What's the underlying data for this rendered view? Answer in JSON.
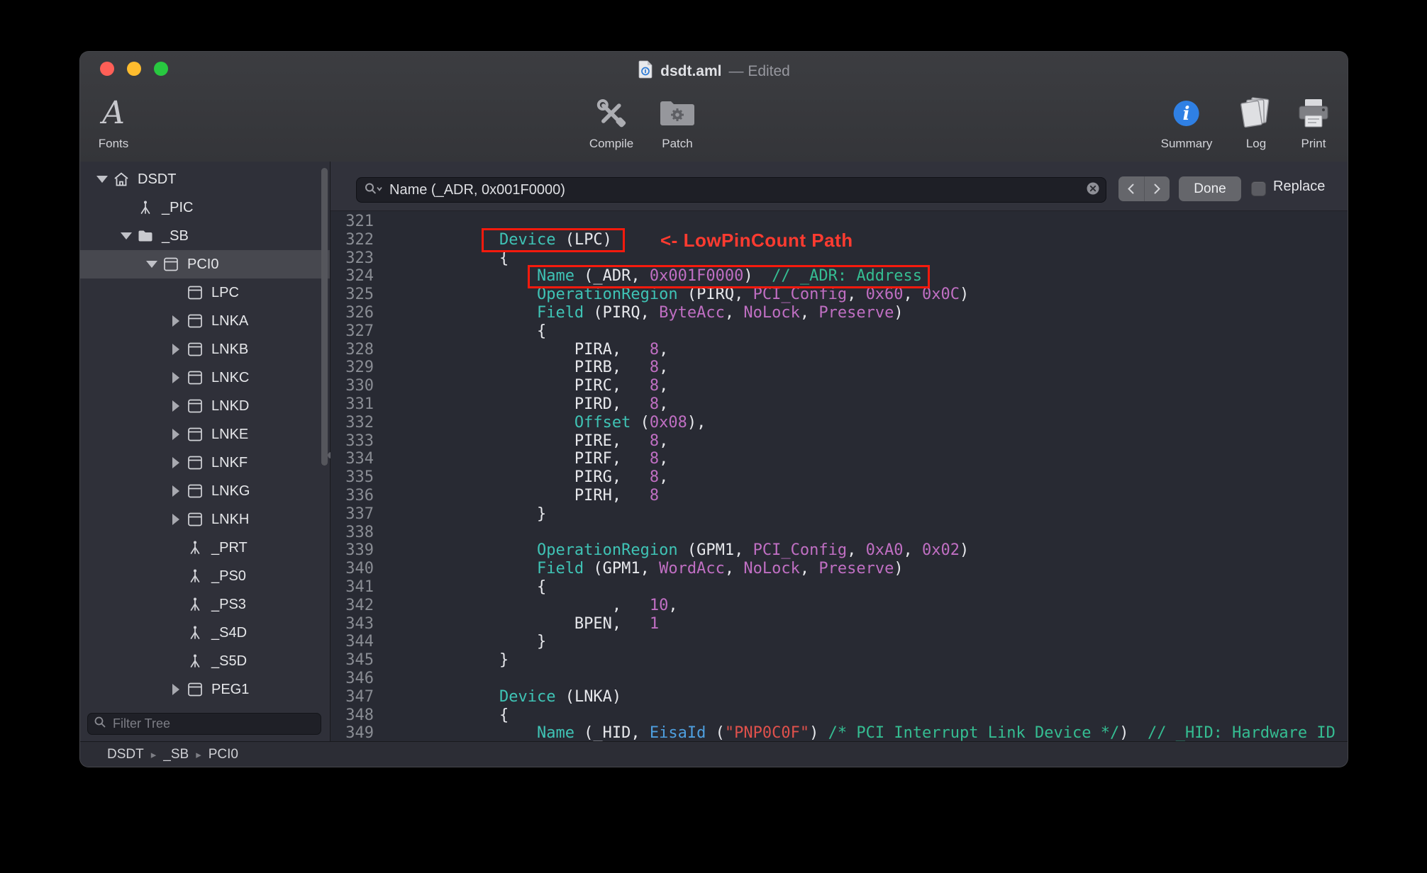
{
  "window": {
    "title": "dsdt.aml",
    "title_suffix": "— Edited"
  },
  "toolbar": {
    "fonts": "Fonts",
    "compile": "Compile",
    "patch": "Patch",
    "summary": "Summary",
    "log": "Log",
    "print": "Print"
  },
  "sidebar": {
    "filter_placeholder": "Filter Tree",
    "items": [
      {
        "label": "DSDT",
        "level": 0,
        "disclosure": "open",
        "icon": "home",
        "selected": false
      },
      {
        "label": "_PIC",
        "level": 1,
        "disclosure": "none",
        "icon": "method",
        "selected": false
      },
      {
        "label": "_SB",
        "level": 1,
        "disclosure": "open",
        "icon": "folder",
        "selected": false
      },
      {
        "label": "PCI0",
        "level": 2,
        "disclosure": "open",
        "icon": "device",
        "selected": true
      },
      {
        "label": "LPC",
        "level": 3,
        "disclosure": "none",
        "icon": "device",
        "selected": false
      },
      {
        "label": "LNKA",
        "level": 3,
        "disclosure": "closed",
        "icon": "device",
        "selected": false
      },
      {
        "label": "LNKB",
        "level": 3,
        "disclosure": "closed",
        "icon": "device",
        "selected": false
      },
      {
        "label": "LNKC",
        "level": 3,
        "disclosure": "closed",
        "icon": "device",
        "selected": false
      },
      {
        "label": "LNKD",
        "level": 3,
        "disclosure": "closed",
        "icon": "device",
        "selected": false
      },
      {
        "label": "LNKE",
        "level": 3,
        "disclosure": "closed",
        "icon": "device",
        "selected": false
      },
      {
        "label": "LNKF",
        "level": 3,
        "disclosure": "closed",
        "icon": "device",
        "selected": false
      },
      {
        "label": "LNKG",
        "level": 3,
        "disclosure": "closed",
        "icon": "device",
        "selected": false
      },
      {
        "label": "LNKH",
        "level": 3,
        "disclosure": "closed",
        "icon": "device",
        "selected": false
      },
      {
        "label": "_PRT",
        "level": 3,
        "disclosure": "none",
        "icon": "method",
        "selected": false
      },
      {
        "label": "_PS0",
        "level": 3,
        "disclosure": "none",
        "icon": "method",
        "selected": false
      },
      {
        "label": "_PS3",
        "level": 3,
        "disclosure": "none",
        "icon": "method",
        "selected": false
      },
      {
        "label": "_S4D",
        "level": 3,
        "disclosure": "none",
        "icon": "method",
        "selected": false
      },
      {
        "label": "_S5D",
        "level": 3,
        "disclosure": "none",
        "icon": "method",
        "selected": false
      },
      {
        "label": "PEG1",
        "level": 3,
        "disclosure": "closed",
        "icon": "device",
        "selected": false
      }
    ]
  },
  "searchbar": {
    "query": "Name (_ADR, 0x001F0000)",
    "done_label": "Done",
    "replace_label": "Replace",
    "replace_checked": false
  },
  "statusbar": {
    "breadcrumbs": [
      "DSDT",
      "_SB",
      "PCI0"
    ]
  },
  "annotations": {
    "note": "<- LowPinCount Path"
  },
  "colors": {
    "annotation_red": "#FF3B30",
    "box_red": "#F71A0D",
    "syntax_keyword": "#3FC3B5",
    "syntax_constant": "#C06FC3",
    "syntax_string": "#E0514C",
    "syntax_comment": "#35BD92",
    "syntax_predefined": "#4E9FDF",
    "syntax_plain": "#E7E8EC",
    "editor_bg": "#282A33"
  },
  "editor": {
    "lines": [
      {
        "n": "321",
        "seg": []
      },
      {
        "n": "322",
        "seg": [
          [
            "p",
            "        "
          ],
          [
            "k",
            "Device"
          ],
          [
            "p",
            " (LPC)"
          ]
        ]
      },
      {
        "n": "323",
        "seg": [
          [
            "p",
            "        {"
          ]
        ]
      },
      {
        "n": "324",
        "seg": [
          [
            "p",
            "            "
          ],
          [
            "k",
            "Name"
          ],
          [
            "p",
            " (_ADR, "
          ],
          [
            "c",
            "0x001F0000"
          ],
          [
            "p",
            ")  "
          ],
          [
            "m",
            "// _ADR: Address"
          ]
        ]
      },
      {
        "n": "325",
        "seg": [
          [
            "p",
            "            "
          ],
          [
            "k",
            "OperationRegion"
          ],
          [
            "p",
            " (PIRQ, "
          ],
          [
            "c",
            "PCI_Config"
          ],
          [
            "p",
            ", "
          ],
          [
            "c",
            "0x60"
          ],
          [
            "p",
            ", "
          ],
          [
            "c",
            "0x0C"
          ],
          [
            "p",
            ")"
          ]
        ]
      },
      {
        "n": "326",
        "seg": [
          [
            "p",
            "            "
          ],
          [
            "k",
            "Field"
          ],
          [
            "p",
            " (PIRQ, "
          ],
          [
            "c",
            "ByteAcc"
          ],
          [
            "p",
            ", "
          ],
          [
            "c",
            "NoLock"
          ],
          [
            "p",
            ", "
          ],
          [
            "c",
            "Preserve"
          ],
          [
            "p",
            ")"
          ]
        ]
      },
      {
        "n": "327",
        "seg": [
          [
            "p",
            "            {"
          ]
        ]
      },
      {
        "n": "328",
        "seg": [
          [
            "p",
            "                PIRA,   "
          ],
          [
            "c",
            "8"
          ],
          [
            "p",
            ","
          ]
        ]
      },
      {
        "n": "329",
        "seg": [
          [
            "p",
            "                PIRB,   "
          ],
          [
            "c",
            "8"
          ],
          [
            "p",
            ","
          ]
        ]
      },
      {
        "n": "330",
        "seg": [
          [
            "p",
            "                PIRC,   "
          ],
          [
            "c",
            "8"
          ],
          [
            "p",
            ","
          ]
        ]
      },
      {
        "n": "331",
        "seg": [
          [
            "p",
            "                PIRD,   "
          ],
          [
            "c",
            "8"
          ],
          [
            "p",
            ","
          ]
        ]
      },
      {
        "n": "332",
        "seg": [
          [
            "p",
            "                "
          ],
          [
            "k",
            "Offset"
          ],
          [
            "p",
            " ("
          ],
          [
            "c",
            "0x08"
          ],
          [
            "p",
            "),"
          ]
        ]
      },
      {
        "n": "333",
        "seg": [
          [
            "p",
            "                PIRE,   "
          ],
          [
            "c",
            "8"
          ],
          [
            "p",
            ","
          ]
        ]
      },
      {
        "n": "334",
        "seg": [
          [
            "p",
            "                PIRF,   "
          ],
          [
            "c",
            "8"
          ],
          [
            "p",
            ","
          ]
        ]
      },
      {
        "n": "335",
        "seg": [
          [
            "p",
            "                PIRG,   "
          ],
          [
            "c",
            "8"
          ],
          [
            "p",
            ","
          ]
        ]
      },
      {
        "n": "336",
        "seg": [
          [
            "p",
            "                PIRH,   "
          ],
          [
            "c",
            "8"
          ]
        ]
      },
      {
        "n": "337",
        "seg": [
          [
            "p",
            "            }"
          ]
        ]
      },
      {
        "n": "338",
        "seg": []
      },
      {
        "n": "339",
        "seg": [
          [
            "p",
            "            "
          ],
          [
            "k",
            "OperationRegion"
          ],
          [
            "p",
            " (GPM1, "
          ],
          [
            "c",
            "PCI_Config"
          ],
          [
            "p",
            ", "
          ],
          [
            "c",
            "0xA0"
          ],
          [
            "p",
            ", "
          ],
          [
            "c",
            "0x02"
          ],
          [
            "p",
            ")"
          ]
        ]
      },
      {
        "n": "340",
        "seg": [
          [
            "p",
            "            "
          ],
          [
            "k",
            "Field"
          ],
          [
            "p",
            " (GPM1, "
          ],
          [
            "c",
            "WordAcc"
          ],
          [
            "p",
            ", "
          ],
          [
            "c",
            "NoLock"
          ],
          [
            "p",
            ", "
          ],
          [
            "c",
            "Preserve"
          ],
          [
            "p",
            ")"
          ]
        ]
      },
      {
        "n": "341",
        "seg": [
          [
            "p",
            "            {"
          ]
        ]
      },
      {
        "n": "342",
        "seg": [
          [
            "p",
            "                    ,   "
          ],
          [
            "c",
            "10"
          ],
          [
            "p",
            ","
          ]
        ]
      },
      {
        "n": "343",
        "seg": [
          [
            "p",
            "                BPEN,   "
          ],
          [
            "c",
            "1"
          ]
        ]
      },
      {
        "n": "344",
        "seg": [
          [
            "p",
            "            }"
          ]
        ]
      },
      {
        "n": "345",
        "seg": [
          [
            "p",
            "        }"
          ]
        ]
      },
      {
        "n": "346",
        "seg": []
      },
      {
        "n": "347",
        "seg": [
          [
            "p",
            "        "
          ],
          [
            "k",
            "Device"
          ],
          [
            "p",
            " (LNKA)"
          ]
        ]
      },
      {
        "n": "348",
        "seg": [
          [
            "p",
            "        {"
          ]
        ]
      },
      {
        "n": "349",
        "seg": [
          [
            "p",
            "            "
          ],
          [
            "k",
            "Name"
          ],
          [
            "p",
            " (_HID, "
          ],
          [
            "e",
            "EisaId"
          ],
          [
            "p",
            " ("
          ],
          [
            "s",
            "\"PNP0C0F\""
          ],
          [
            "p",
            ") "
          ],
          [
            "m",
            "/* PCI Interrupt Link Device */"
          ],
          [
            "p",
            ")  "
          ],
          [
            "m",
            "// _HID: Hardware ID"
          ]
        ]
      }
    ]
  }
}
